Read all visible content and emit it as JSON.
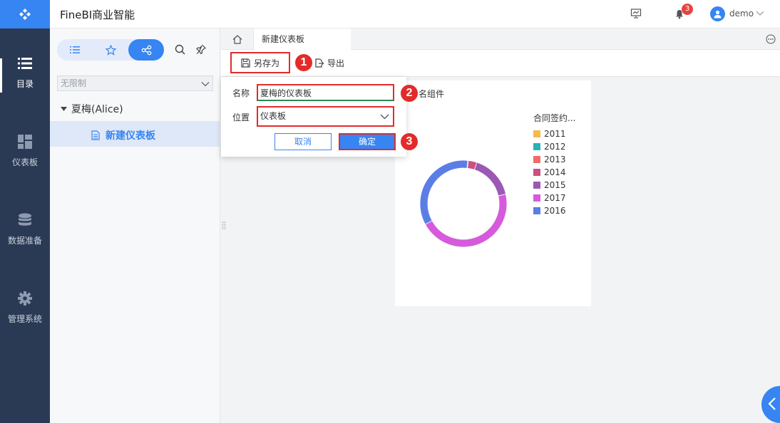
{
  "header": {
    "title": "FineBI商业智能",
    "notification_count": "3",
    "user_name": "demo"
  },
  "rail": {
    "items": [
      {
        "label": "目录",
        "icon": "list-icon",
        "active": true
      },
      {
        "label": "仪表板",
        "icon": "dashboard-icon",
        "active": false
      },
      {
        "label": "数据准备",
        "icon": "database-icon",
        "active": false
      },
      {
        "label": "管理系统",
        "icon": "gear-icon",
        "active": false
      }
    ]
  },
  "directory": {
    "filter_value": "无限制",
    "user_node": "夏梅(Alice)",
    "selected_item": "新建仪表板"
  },
  "tabs": {
    "active_tab": "新建仪表板"
  },
  "toolbar": {
    "save_as_label": "另存为",
    "export_label": "导出"
  },
  "markers": [
    "1",
    "2",
    "3"
  ],
  "dialog": {
    "name_label": "名称",
    "name_value": "夏梅的仪表板",
    "location_label": "位置",
    "location_value": "仪表板",
    "cancel_label": "取消",
    "ok_label": "确定"
  },
  "widget": {
    "title_partial": "名组件",
    "chart_data": {
      "type": "pie",
      "legend_title": "合同签约...",
      "categories": [
        "2011",
        "2012",
        "2013",
        "2014",
        "2015",
        "2016",
        "2017"
      ],
      "values": [
        0,
        0,
        0.2,
        3.2,
        16.5,
        34.5,
        45.6
      ],
      "colors": {
        "2011": "#f7b94a",
        "2012": "#27b3b5",
        "2013": "#f06b6b",
        "2014": "#cc5080",
        "2015": "#9b59b6",
        "2016": "#5b7ee6",
        "2017": "#d65bdc"
      },
      "legend_order": [
        "2011",
        "2012",
        "2013",
        "2014",
        "2015",
        "2017",
        "2016"
      ]
    }
  },
  "colors": {
    "accent": "#3685f2",
    "rail_bg": "#2b3a54",
    "highlight": "#e32b2b"
  }
}
